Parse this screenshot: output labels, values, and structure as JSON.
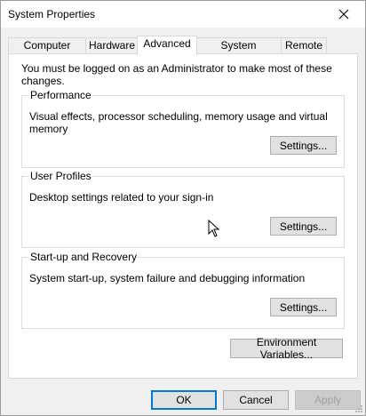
{
  "window": {
    "title": "System Properties",
    "close_icon": "close-icon"
  },
  "tabs": [
    {
      "label": "Computer Name",
      "selected": false
    },
    {
      "label": "Hardware",
      "selected": false
    },
    {
      "label": "Advanced",
      "selected": true
    },
    {
      "label": "System Protection",
      "selected": false
    },
    {
      "label": "Remote",
      "selected": false
    }
  ],
  "panel": {
    "notice": "You must be logged on as an Administrator to make most of these changes."
  },
  "groups": {
    "performance": {
      "label": "Performance",
      "description": "Visual effects, processor scheduling, memory usage and virtual memory",
      "button": "Settings..."
    },
    "user_profiles": {
      "label": "User Profiles",
      "description": "Desktop settings related to your sign-in",
      "button": "Settings..."
    },
    "startup_recovery": {
      "label": "Start-up and Recovery",
      "description": "System start-up, system failure and debugging information",
      "button": "Settings..."
    }
  },
  "env_button": "Environment Variables...",
  "footer": {
    "ok": "OK",
    "cancel": "Cancel",
    "apply": "Apply"
  },
  "colors": {
    "focus_border": "#0078d7",
    "disabled_text": "#a0a0a0"
  }
}
